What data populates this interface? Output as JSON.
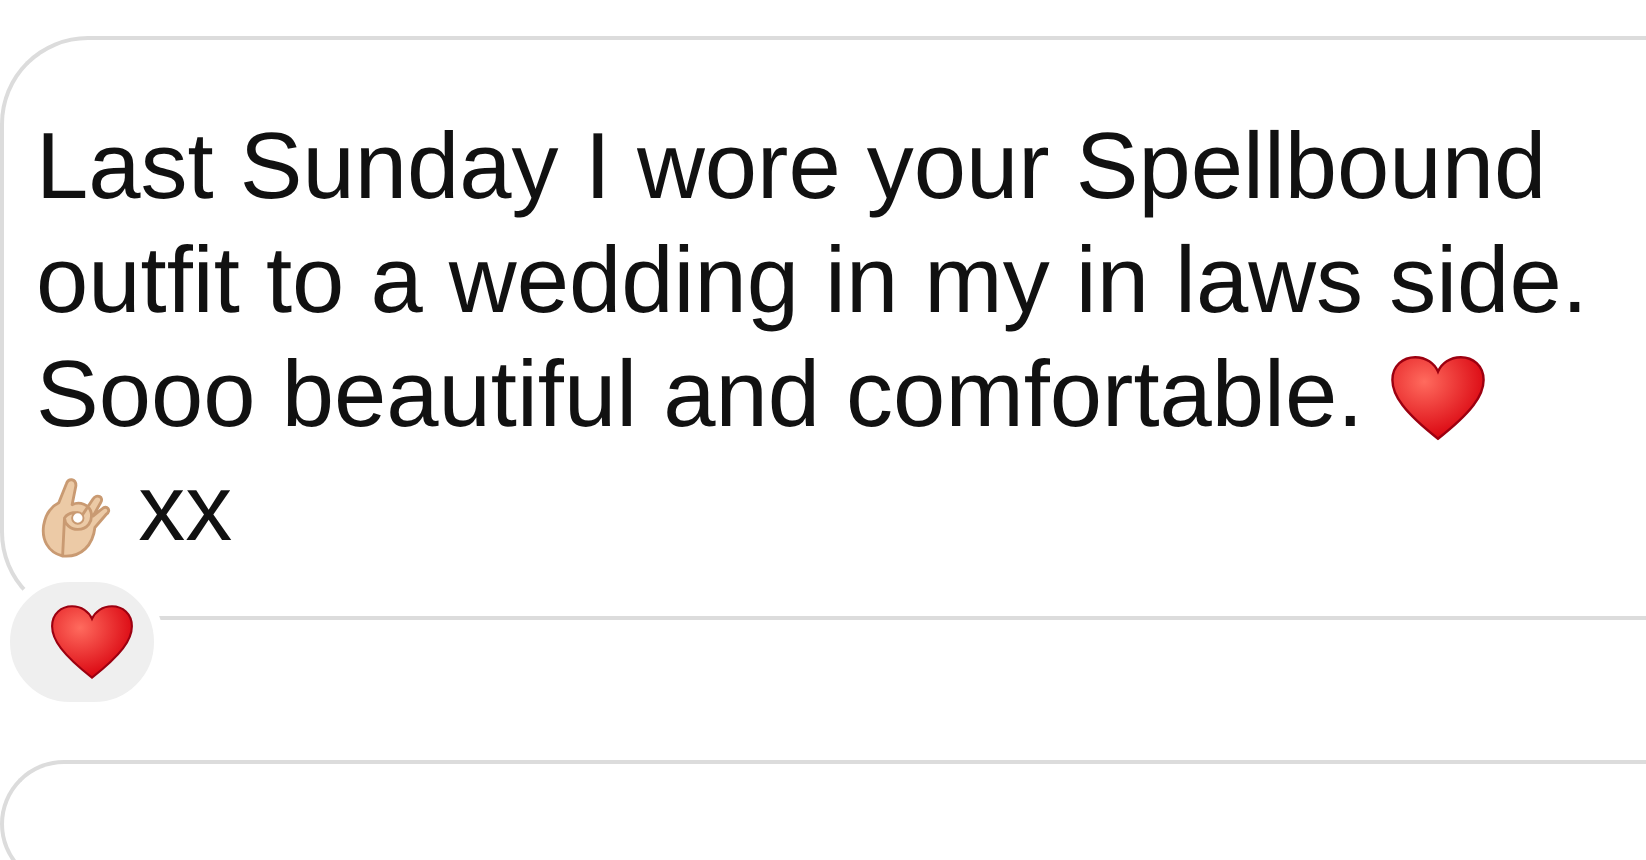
{
  "messages": [
    {
      "lines": [
        "Last Sunday I wore your Spellbound",
        "outfit to a wedding in my in laws side.",
        "Sooo beautiful and comfortable."
      ],
      "closing": "xx",
      "reacted": true
    },
    {
      "reacted": false
    }
  ]
}
